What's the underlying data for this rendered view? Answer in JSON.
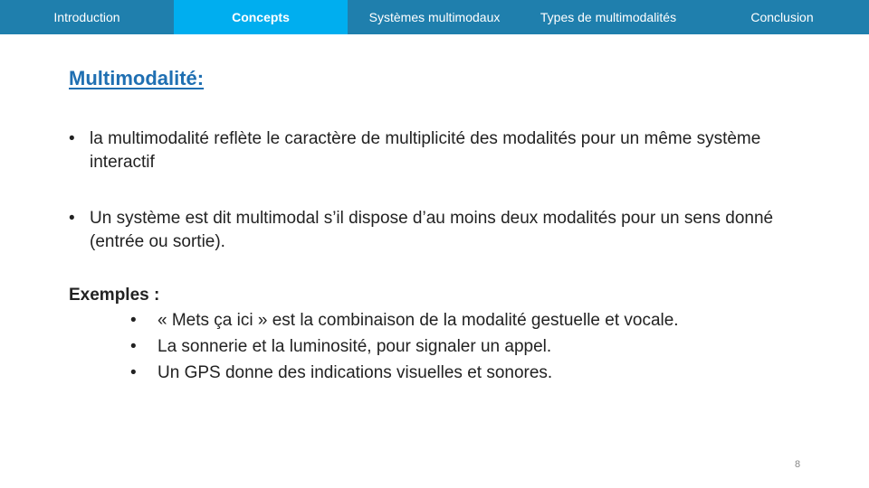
{
  "nav": {
    "items": [
      {
        "label": "Introduction",
        "active": false
      },
      {
        "label": "Concepts",
        "active": true
      },
      {
        "label": "Systèmes multimodaux",
        "active": false
      },
      {
        "label": "Types de multimodalités",
        "active": false
      },
      {
        "label": "Conclusion",
        "active": false
      }
    ],
    "colors": {
      "bar": "#1f7fad",
      "active": "#00aeef",
      "text": "#ffffff"
    }
  },
  "slide": {
    "title": "Multimodalité:",
    "title_color": "#1f6fb2",
    "bullet_glyph": "•",
    "bullets": [
      {
        "text": "la multimodalité reflète le caractère de multiplicité des modalités pour un même système interactif"
      },
      {
        "text": "Un système est dit multimodal s’il dispose d’au moins deux modalités pour un sens donné (entrée ou sortie)."
      }
    ],
    "examples": {
      "title": "Exemples :",
      "items": [
        {
          "text": "« Mets ça ici » est la combinaison de la modalité gestuelle et vocale."
        },
        {
          "text": "La sonnerie et la luminosité, pour signaler un appel."
        },
        {
          "text": "Un GPS donne des indications visuelles et sonores."
        }
      ]
    },
    "page_number": "8"
  }
}
